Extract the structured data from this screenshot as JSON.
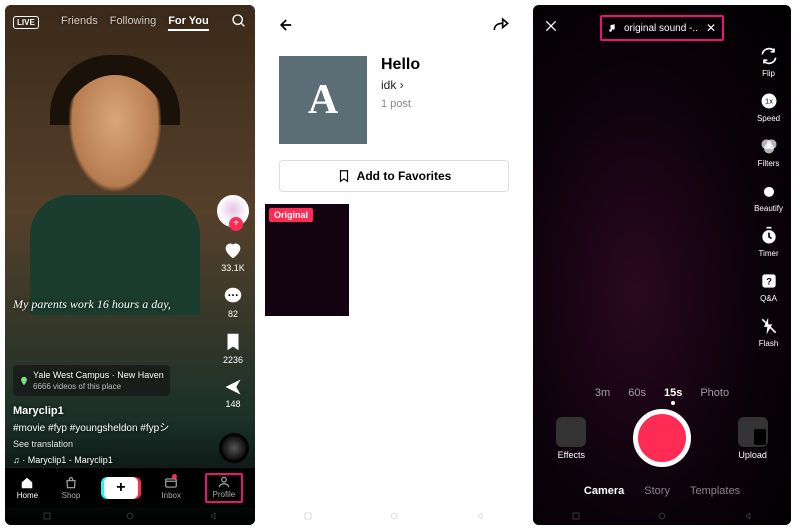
{
  "panel1": {
    "tabs": {
      "friends": "Friends",
      "following": "Following",
      "foryou": "For You"
    },
    "live_badge": "LIVE",
    "caption_overlay": "My parents work 16 hours a day,",
    "location": {
      "name": "Yale West Campus · New Haven",
      "subtitle": "6666 videos of this place"
    },
    "username": "Maryclip1",
    "hashtags": "#movie #fyp #youngsheldon #fypシ",
    "see_translation": "See translation",
    "marquee": "♫ · Maryclip1 - Maryclip1",
    "counts": {
      "likes": "33.1K",
      "comments": "82",
      "saves": "2236",
      "shares": "148"
    },
    "nav": {
      "home": "Home",
      "shop": "Shop",
      "inbox": "Inbox",
      "profile": "Profile"
    }
  },
  "panel2": {
    "sound_letter": "A",
    "title": "Hello",
    "author": "idk",
    "posts": "1 post",
    "add_favorites": "Add to Favorites",
    "original_badge": "Original"
  },
  "panel3": {
    "sound_label": "original sound -..",
    "tools": {
      "flip": "Flip",
      "speed": "Speed",
      "filters": "Filters",
      "beautify": "Beautify",
      "timer": "Timer",
      "qa": "Q&A",
      "flash": "Flash"
    },
    "speed_value": "1x",
    "durations": {
      "d3m": "3m",
      "d60s": "60s",
      "d15s": "15s",
      "photo": "Photo"
    },
    "effects": "Effects",
    "upload": "Upload",
    "modes": {
      "camera": "Camera",
      "story": "Story",
      "templates": "Templates"
    }
  }
}
